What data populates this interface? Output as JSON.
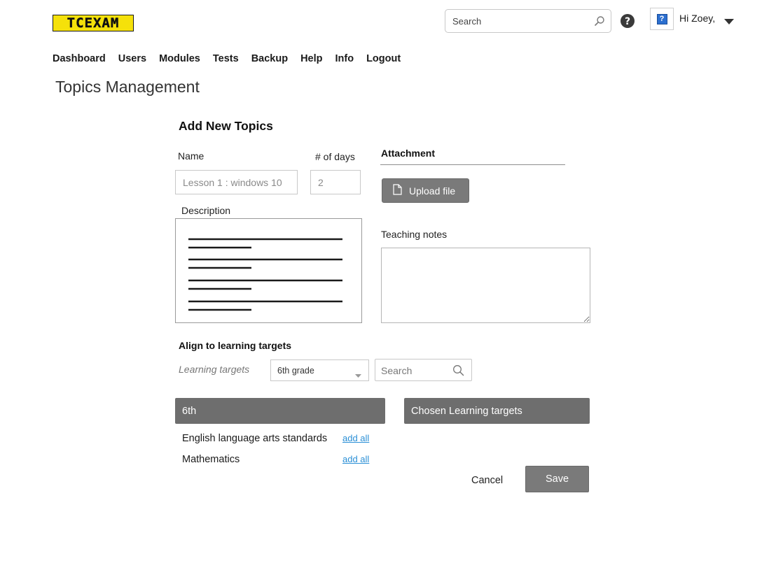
{
  "header": {
    "logo_text": "TCEXAM",
    "search_placeholder": "Search",
    "greeting": "Hi Zoey,",
    "user_icon": "question-mark-icon"
  },
  "nav": [
    {
      "label": "Dashboard"
    },
    {
      "label": "Users"
    },
    {
      "label": "Modules"
    },
    {
      "label": "Tests"
    },
    {
      "label": "Backup"
    },
    {
      "label": "Help"
    },
    {
      "label": "Info"
    },
    {
      "label": "Logout"
    }
  ],
  "page_title": "Topics Management",
  "form": {
    "section_title": "Add New Topics",
    "name_label": "Name",
    "name_placeholder": "Lesson 1 : windows 10",
    "days_label": "# of days",
    "days_placeholder": "2",
    "description_label": "Description",
    "attachment_title": "Attachment",
    "upload_label": "Upload file",
    "teaching_notes_label": "Teaching notes"
  },
  "learning_targets": {
    "section_title": "Align to learning targets",
    "label": "Learning targets",
    "grade_selected": "6th grade",
    "search_placeholder": "Search",
    "grade_panel_title": "6th",
    "chosen_panel_title": "Chosen Learning targets",
    "items": [
      {
        "name": "English language arts standards",
        "action": "add all"
      },
      {
        "name": "Mathematics",
        "action": "add all"
      }
    ]
  },
  "actions": {
    "cancel_label": "Cancel",
    "save_label": "Save"
  },
  "colors": {
    "logo_bg": "#f5e10a",
    "button_gray": "#7a7a7a",
    "link_blue": "#2a8fd6"
  }
}
